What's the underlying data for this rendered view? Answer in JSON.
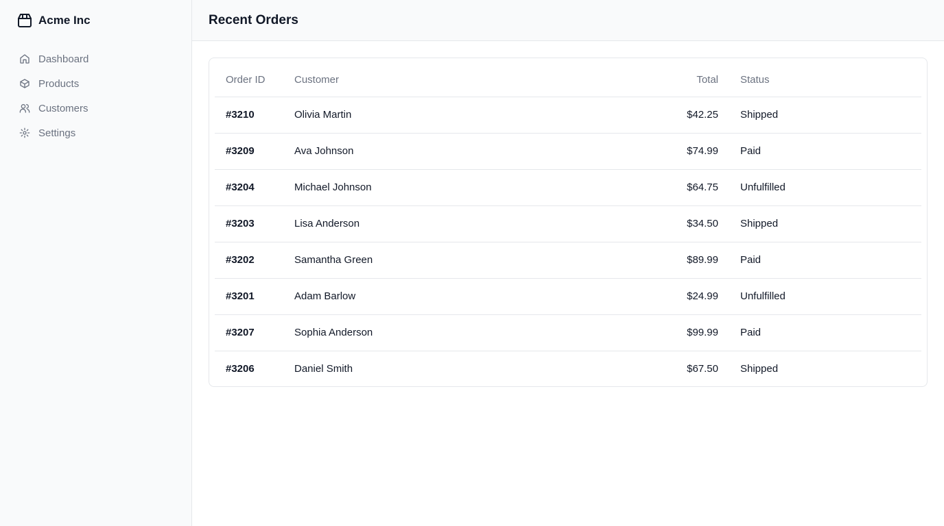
{
  "brand": {
    "name": "Acme Inc",
    "icon": "package-icon"
  },
  "sidebar": {
    "items": [
      {
        "label": "Dashboard",
        "icon": "home-icon"
      },
      {
        "label": "Products",
        "icon": "box-icon"
      },
      {
        "label": "Customers",
        "icon": "users-icon"
      },
      {
        "label": "Settings",
        "icon": "gear-icon"
      }
    ]
  },
  "header": {
    "title": "Recent Orders"
  },
  "orders": {
    "columns": [
      "Order ID",
      "Customer",
      "Total",
      "Status"
    ],
    "rows": [
      {
        "id": "#3210",
        "customer": "Olivia Martin",
        "total": "$42.25",
        "status": "Shipped"
      },
      {
        "id": "#3209",
        "customer": "Ava Johnson",
        "total": "$74.99",
        "status": "Paid"
      },
      {
        "id": "#3204",
        "customer": "Michael Johnson",
        "total": "$64.75",
        "status": "Unfulfilled"
      },
      {
        "id": "#3203",
        "customer": "Lisa Anderson",
        "total": "$34.50",
        "status": "Shipped"
      },
      {
        "id": "#3202",
        "customer": "Samantha Green",
        "total": "$89.99",
        "status": "Paid"
      },
      {
        "id": "#3201",
        "customer": "Adam Barlow",
        "total": "$24.99",
        "status": "Unfulfilled"
      },
      {
        "id": "#3207",
        "customer": "Sophia Anderson",
        "total": "$99.99",
        "status": "Paid"
      },
      {
        "id": "#3206",
        "customer": "Daniel Smith",
        "total": "$67.50",
        "status": "Shipped"
      }
    ]
  },
  "colors": {
    "sidebar_bg": "#f9fafb",
    "border": "#e5e7eb",
    "muted_text": "#6b7280",
    "text": "#111827"
  }
}
